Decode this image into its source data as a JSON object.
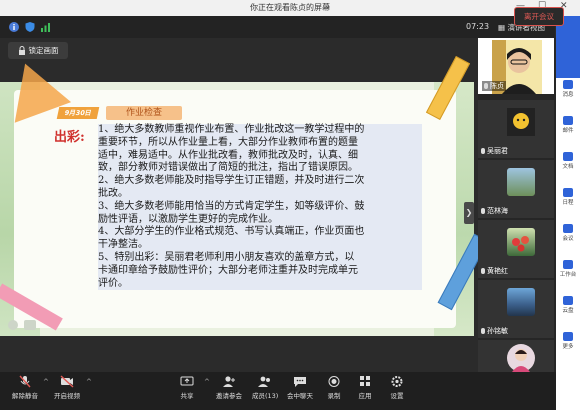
{
  "window": {
    "title": "你正在观看陈贞的屏幕"
  },
  "topbar": {
    "time": "07:23",
    "speaker_view": "演讲者视图"
  },
  "lock_button": {
    "label": "锁定画面"
  },
  "slide": {
    "date_tag": "9月30日",
    "topic": "作业检查",
    "highlight_label": "出彩:",
    "lines": [
      "1、绝大多数教师重视作业布置、作业批改这一教学过程中的",
      "重要环节，所以从作业量上看，大部分作业教师布置的题量",
      "适中，难易适中。从作业批改看，教师批改及时，认真、细",
      "致，部分教师对错误做出了简短的批注，指出了错误原因。",
      "2、绝大多数老师能及时指导学生订正错题，并及时进行二次",
      "批改。",
      "3、绝大多数老师能用恰当的方式肯定学生，如等级评价、鼓",
      "励性评语，以激励学生更好的完成作业。",
      "4、大部分学生的作业格式规范、书写认真端正，作业页面也",
      "干净整洁。",
      "5、特别出彩：吴丽君老师利用小朋友喜欢的盖章方式，以",
      "卡通印章给予鼓励性评价；大部分老师注重并及时完成单元",
      "评价。"
    ]
  },
  "participants": [
    {
      "name": "陈贞"
    },
    {
      "name": "吴丽君"
    },
    {
      "name": "范林海"
    },
    {
      "name": "黄艳红"
    },
    {
      "name": "孙铭敏"
    },
    {
      "name": ""
    }
  ],
  "rightbar": {
    "items": [
      "消息",
      "邮件",
      "文档",
      "日程",
      "会议",
      "工作台",
      "云盘",
      "更多"
    ]
  },
  "bottombar": {
    "mute": "解除静音",
    "video": "开启视频",
    "share": "共享",
    "invite": "邀请参会",
    "members": "成员(13)",
    "chat": "会中聊天",
    "record": "录制",
    "apps": "应用",
    "settings": "设置",
    "leave": "离开会议"
  },
  "colors": {
    "accent": "#2f63d8",
    "leave": "#e05a55",
    "highlight": "#d0312d",
    "tag": "#f0a23c"
  }
}
